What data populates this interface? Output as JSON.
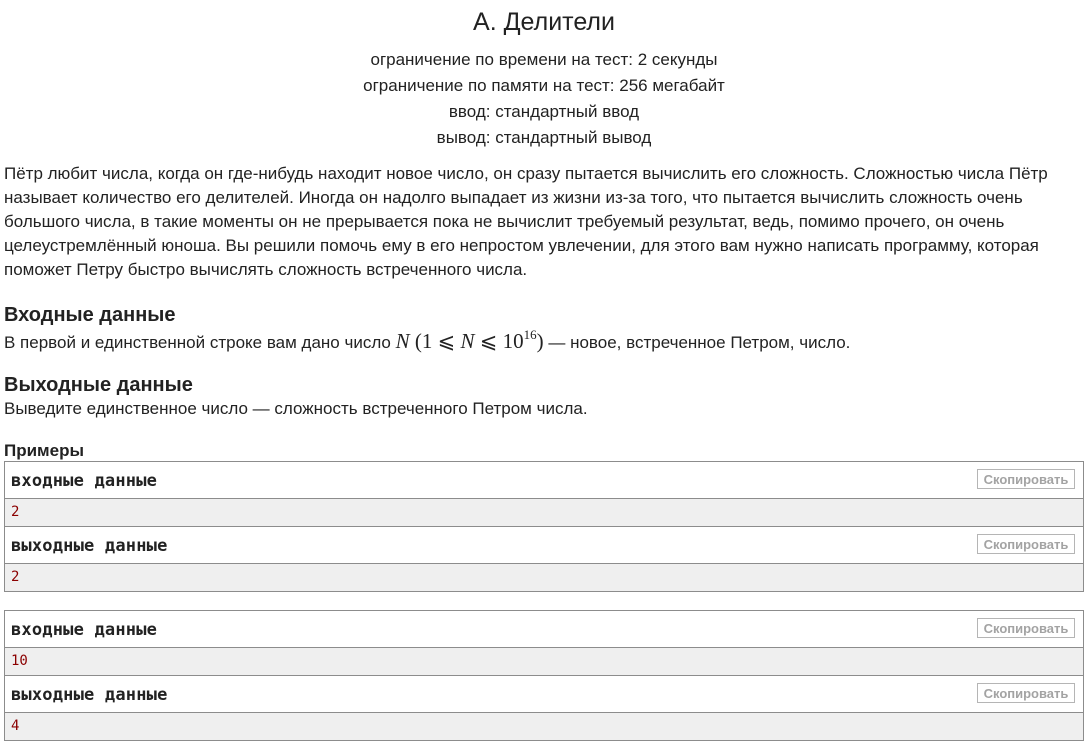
{
  "problem": {
    "title": "A. Делители",
    "limits": [
      "ограничение по времени на тест: 2 секунды",
      "ограничение по памяти на тест: 256 мегабайт",
      "ввод: стандартный ввод",
      "вывод: стандартный вывод"
    ],
    "legend": "Пётр любит числа, когда он где-нибудь находит новое число, он сразу пытается вычислить его сложность. Сложностью числа Пётр называет количество его делителей. Иногда он надолго выпадает из жизни из-за того, что пытается вычислить сложность очень большого числа, в такие моменты он не прерывается пока не вычислит требуемый результат, ведь, помимо прочего, он очень целеустремлённый юноша. Вы решили помочь ему в его непростом увлечении, для этого вам нужно написать программу, которая поможет Петру быстро вычислять сложность встреченного числа."
  },
  "input_spec": {
    "title": "Входные данные",
    "text_before": "В первой и единственной строке вам дано число",
    "math_var": "N",
    "math_open": "(1 ⩽",
    "math_var2": "N",
    "math_le": "⩽ 10",
    "math_exp": "16",
    "math_close": ")",
    "text_after": "— новое, встреченное Петром, число."
  },
  "output_spec": {
    "title": "Выходные данные",
    "text": "Выведите единственное число — сложность встреченного Петром числа."
  },
  "examples": {
    "title": "Примеры",
    "copy_label": "Скопировать",
    "input_label": "входные данные",
    "output_label": "выходные данные",
    "tests": [
      {
        "input": "2",
        "output": "2"
      },
      {
        "input": "10",
        "output": "4"
      }
    ]
  }
}
